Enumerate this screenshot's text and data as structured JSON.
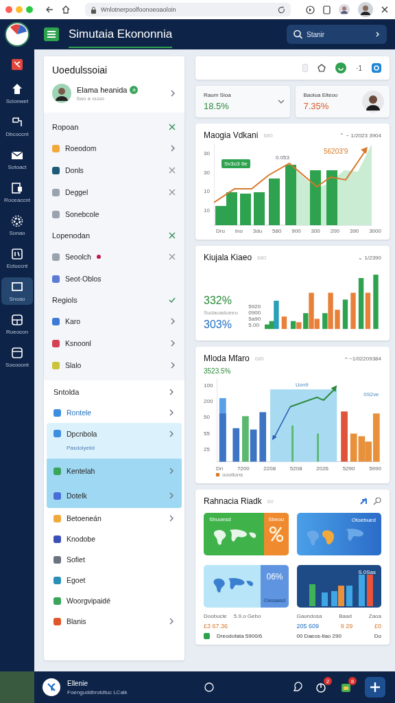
{
  "browser": {
    "url": "Wnlotnerpoolfoonoeoaoloin"
  },
  "header": {
    "title": "Simutaia Ekononnia",
    "search": {
      "placeholder": "Stanir"
    }
  },
  "rail": {
    "items": [
      {
        "selected": false
      },
      {
        "label": "Scionwet",
        "selected": false
      },
      {
        "label": "Dbcoccnt",
        "selected": false
      },
      {
        "label": "Sotoact",
        "selected": false
      },
      {
        "label": "Roceaccnt",
        "selected": false
      },
      {
        "label": "Sonao",
        "selected": false
      },
      {
        "label": "Ectuccnt",
        "selected": false
      },
      {
        "label": "Snoao",
        "selected": true
      },
      {
        "label": "Roeocon",
        "selected": false
      },
      {
        "label": "Socooont",
        "selected": false
      }
    ]
  },
  "panel": {
    "title": "Uoedulssoiai",
    "profile": {
      "name": "Elama heanida",
      "badge": "a",
      "subtitle": "6ao a ouuo"
    },
    "groups": [
      {
        "title": "Ropoan",
        "checked": false,
        "items": [
          {
            "label": "Roeodom",
            "color": "#f2a93b",
            "kind": "chevron"
          },
          {
            "label": "Donls",
            "color": "#1d5a78",
            "kind": "close"
          },
          {
            "label": "Deggel",
            "color": "#9aa3ad",
            "kind": "close"
          },
          {
            "label": "Sonebcole",
            "color": "#9aa3ad",
            "kind": "plain"
          }
        ]
      },
      {
        "title": "Lopenodan",
        "checked": false,
        "items": [
          {
            "label": "Seoolch",
            "color": "#9aa3ad",
            "kind": "close",
            "dot": true
          },
          {
            "label": "Seot·Oblos",
            "color": "#5b7bd5",
            "kind": "plain",
            "dot": false
          }
        ]
      },
      {
        "title": "Regiols",
        "checked": true,
        "items": [
          {
            "label": "Karo",
            "color": "#3d7ad6",
            "kind": "chevron"
          },
          {
            "label": "Ksnoonl",
            "color": "#d64050",
            "kind": "chevron"
          },
          {
            "label": "Slalo",
            "color": "#c9c43a",
            "kind": "chevron"
          }
        ]
      }
    ],
    "nav": {
      "title": "Sntolda",
      "items": [
        {
          "label": "Rontele",
          "color": "#3d8ee0",
          "kind": "chevron",
          "selected": false,
          "expanded": false
        },
        {
          "label": "Dpcnbola",
          "color": "#3d8ee0",
          "kind": "chevron",
          "selected": false,
          "expanded": true,
          "subtitle": "Pasdolyeild"
        },
        {
          "label": "Kentelah",
          "color": "#3aa55a",
          "kind": "chevron",
          "selected": true,
          "expanded": false
        },
        {
          "label": "Dotelk",
          "color": "#4a6ed8",
          "kind": "chevron",
          "selected": true,
          "expanded": false
        },
        {
          "label": "Betoeneán",
          "color": "#f2a93b",
          "kind": "chevron",
          "selected": false,
          "expanded": false
        },
        {
          "label": "Knodobe",
          "color": "#3b4fb8",
          "kind": "plain",
          "selected": false,
          "expanded": false
        },
        {
          "label": "Sofiet",
          "color": "#6b7280",
          "kind": "plain",
          "selected": false,
          "expanded": false
        },
        {
          "label": "Egoet",
          "color": "#2a8fb8",
          "kind": "plain",
          "selected": false,
          "expanded": false
        },
        {
          "label": "Woorgvipaidé",
          "color": "#3aa55a",
          "kind": "plain",
          "selected": false,
          "expanded": false
        },
        {
          "label": "Blanis",
          "color": "#e0562a",
          "kind": "chevron",
          "selected": false,
          "expanded": false
        }
      ]
    }
  },
  "toolbar": {
    "count": "·1"
  },
  "stats": [
    {
      "label": "Raum Sioa",
      "value": "18.5%",
      "color": "#2a8a3a",
      "kind": "dropdown"
    },
    {
      "label": "Baolua Eiteoo",
      "value": "7.35%",
      "color": "#d65a2a",
      "kind": "avatar"
    }
  ],
  "cards": [
    {
      "kind": "combo",
      "title": "Maogia Vdkani",
      "tag": "680",
      "meta": "⌃ ~ 1/2023 3904",
      "y_labels": [
        "30",
        "30",
        "10",
        "10"
      ],
      "x_labels": [
        "Dru",
        "Ino",
        "3du",
        "580",
        "900",
        "300",
        "200",
        "390",
        "3000"
      ],
      "badge": "Sv3o3 6e",
      "note": "0.053",
      "peak": "56203'9"
    },
    {
      "kind": "mixed",
      "title": "Kiujala Kiaeo",
      "tag": "680",
      "meta": "⌄ 1/2390",
      "big": "332%",
      "caption": "Sudauadueeu",
      "big2": "303%",
      "y_labels": [
        "5920",
        "0900",
        "5a90",
        "5.00"
      ]
    },
    {
      "kind": "bars",
      "title": "Mloda Mfaro",
      "tag": "680",
      "meta": "^ ~1/02209384",
      "big": "3523.5%",
      "y_labels": [
        "100",
        "200",
        "50",
        "55",
        "25"
      ],
      "x_labels": [
        "Dn",
        "7200",
        "2208",
        "5208",
        "2026",
        "5290",
        "5990"
      ],
      "note": "Uon9",
      "note2": "0S2ve",
      "legend": "oootlons"
    },
    {
      "kind": "tiles",
      "title": "Rahnacia Riadk",
      "tag": "60",
      "tiles": [
        {
          "top": "Shuoesd",
          "side": "Sbeoo"
        },
        {
          "top": "Otoebued"
        },
        {
          "value": "06%",
          "bottom": "Oasaasd"
        },
        {
          "top": "S.0Sas"
        }
      ],
      "left": {
        "head": [
          "Doobucle",
          "5.9.o Gebo"
        ],
        "value": "£3 67.36",
        "check": "Dreodofata 5900/6",
        "checked": true
      },
      "right": {
        "head": [
          "Gaundosa",
          "Baad",
          "Zaoa"
        ],
        "values": [
          "205 609",
          "9 29",
          "£0"
        ],
        "foot": [
          "00 Daeos-tlao 290",
          "Do"
        ]
      }
    }
  ],
  "footer": {
    "name": "Ellenie",
    "subtitle": "Foenguddbrotdtuc LCalk",
    "badges": [
      "2",
      "8"
    ]
  }
}
